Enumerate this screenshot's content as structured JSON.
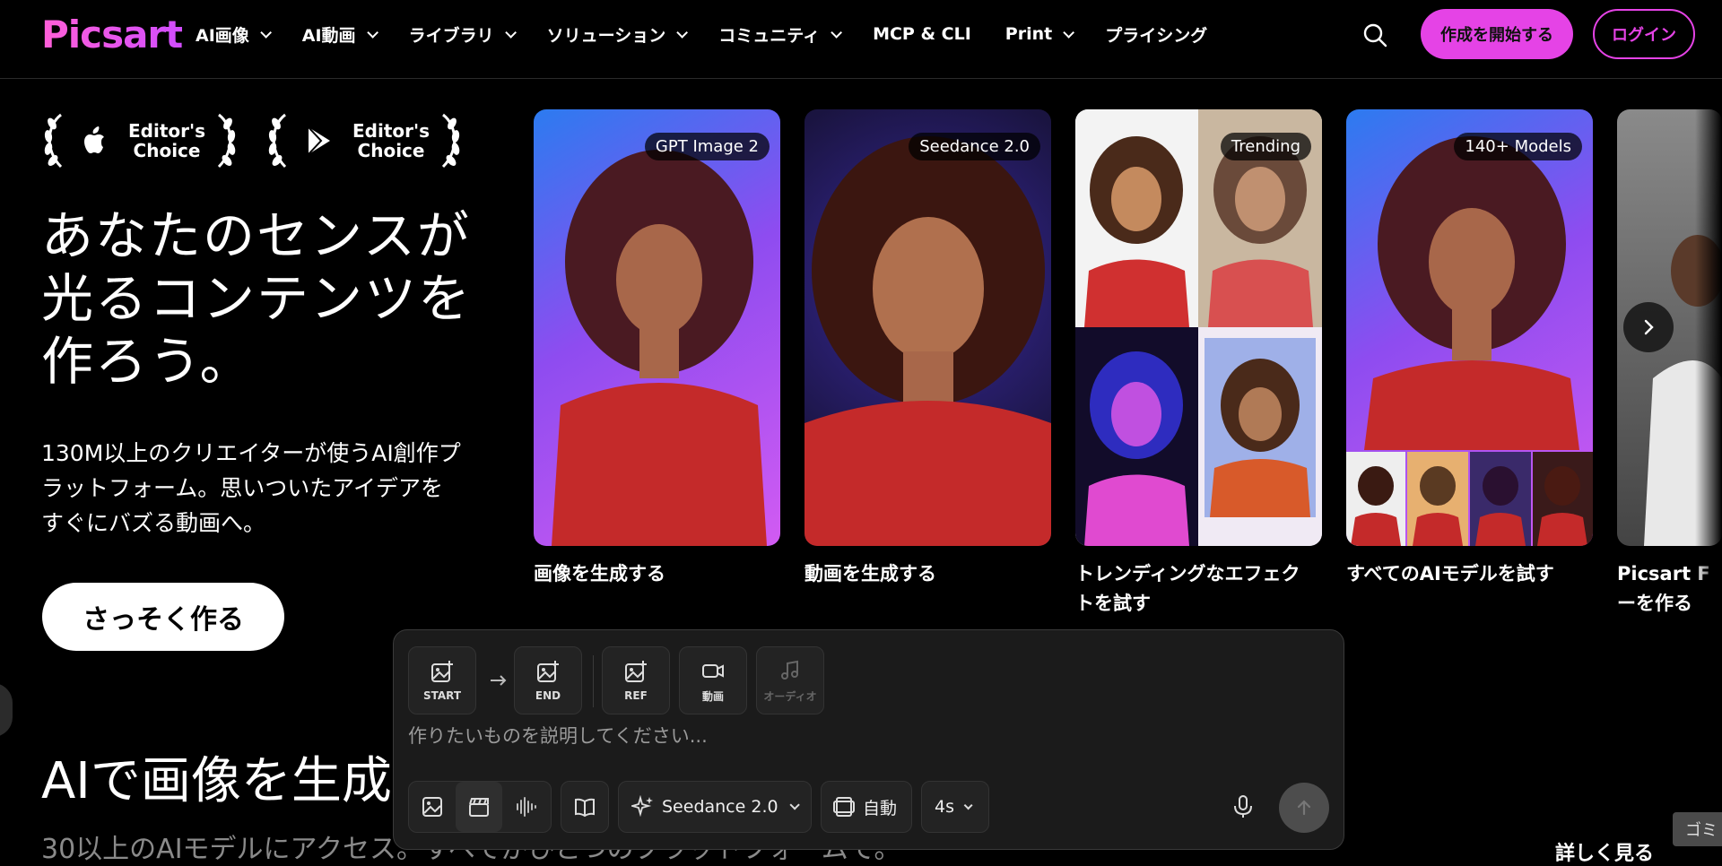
{
  "brand": {
    "logo_text": "Picsart",
    "accent_color": "#e543e6"
  },
  "nav": {
    "items": [
      {
        "label": "AI画像",
        "dropdown": true
      },
      {
        "label": "AI動画",
        "dropdown": true
      },
      {
        "label": "ライブラリ",
        "dropdown": true
      },
      {
        "label": "ソリューション",
        "dropdown": true
      },
      {
        "label": "コミュニティ",
        "dropdown": true
      },
      {
        "label": "MCP & CLI",
        "dropdown": false
      },
      {
        "label": "Print",
        "dropdown": true
      },
      {
        "label": "プライシング",
        "dropdown": false
      }
    ],
    "start_button": "作成を開始する",
    "login_button": "ログイン"
  },
  "hero": {
    "awards": [
      {
        "line1": "Editor's",
        "line2": "Choice",
        "store": "apple-icon"
      },
      {
        "line1": "Editor's",
        "line2": "Choice",
        "store": "google-play-icon"
      }
    ],
    "title_line1": "あなたのセンスが",
    "title_line2": "光るコンテンツを",
    "title_line3": "作ろう。",
    "subtitle_line1": "130M以上のクリエイターが使うAI創作プ",
    "subtitle_line2": "ラットフォーム。思いついたアイデアを",
    "subtitle_line3": "すぐにバズる動画へ。",
    "cta": "さっそく作る"
  },
  "cards": [
    {
      "tag": "GPT Image 2",
      "caption": "画像を生成する"
    },
    {
      "tag": "Seedance 2.0",
      "caption": "動画を生成する"
    },
    {
      "tag": "Trending",
      "caption_line1": "トレンディングなエフェク",
      "caption_line2": "トを試す"
    },
    {
      "tag": "140+ Models",
      "caption": "すべてのAIモデルを試す"
    },
    {
      "caption_line1": "Picsart F",
      "caption_line2": "ーを作る"
    }
  ],
  "composer": {
    "slots": [
      {
        "label": "START",
        "icon": "image-add-icon",
        "enabled": true
      },
      {
        "label": "END",
        "icon": "image-add-icon",
        "enabled": true
      },
      {
        "label": "REF",
        "icon": "image-add-icon",
        "enabled": true
      },
      {
        "label": "動画",
        "icon": "video-icon",
        "enabled": true
      },
      {
        "label": "オーディオ",
        "icon": "music-icon",
        "enabled": false
      }
    ],
    "placeholder": "作りたいものを説明してください...",
    "model": "Seedance 2.0",
    "aspect": "自動",
    "duration": "4s"
  },
  "section": {
    "title": "AIで画像を生成",
    "subtitle": "30以上のAIモデルにアクセス。すべてがひとつのプラットフォームで。",
    "more_link": "詳しく見る",
    "trash_chip": "ゴミ"
  }
}
